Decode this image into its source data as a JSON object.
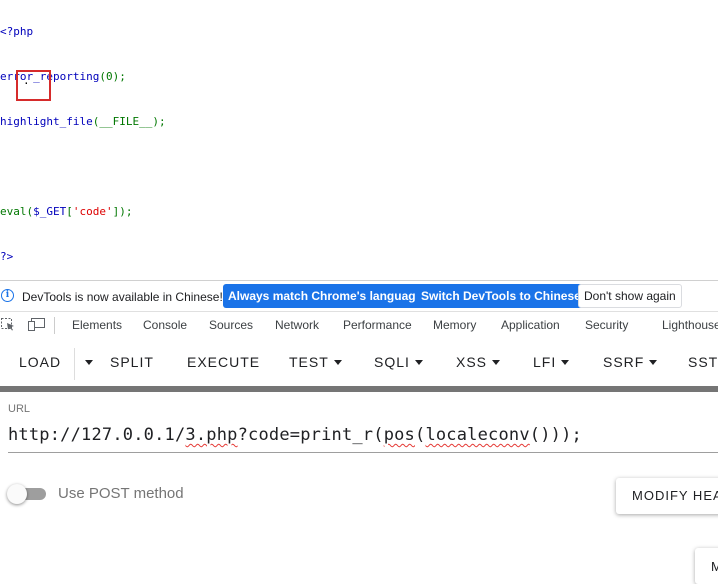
{
  "php_source": {
    "line1": "<?php",
    "line2_fn": "error_reporting",
    "line2_args": "(0);",
    "line3_fn": "highlight_file",
    "line3_args": "(__FILE__);",
    "line5_eval": "eval(",
    "line5_var": "$_GET",
    "line5_open": "[",
    "line5_key": "'code'",
    "line5_close": "]);",
    "line6": "?>",
    "output": "."
  },
  "devtools_infobar": {
    "message": "DevTools is now available in Chinese!",
    "btn_match": "Always match Chrome's language",
    "btn_switch": "Switch DevTools to Chinese",
    "btn_dismiss": "Don't show again"
  },
  "devtools_tabs": [
    "Elements",
    "Console",
    "Sources",
    "Network",
    "Performance",
    "Memory",
    "Application",
    "Security",
    "Lighthouse"
  ],
  "hackbar": {
    "load": "LOAD",
    "split": "SPLIT",
    "execute": "EXECUTE",
    "test": "TEST",
    "sqli": "SQLI",
    "xss": "XSS",
    "lfi": "LFI",
    "ssrf": "SSRF",
    "ssti": "SSTI"
  },
  "url_field": {
    "label": "URL",
    "value_part1": "http://127.0.0.1/",
    "value_part2": "3.php",
    "value_part3": "?code=print_r(",
    "value_part4": "pos",
    "value_part5": "(",
    "value_part6": "localeconv",
    "value_part7": "()));"
  },
  "post_toggle": {
    "label": "Use POST method",
    "enabled": false
  },
  "buttons": {
    "modify_headers": "MODIFY HEADER",
    "bottom_partial": "M"
  },
  "colors": {
    "php_keyword": "#0000BB",
    "php_punct": "#007700",
    "php_string": "#DD0000",
    "accent": "#1a73e8"
  }
}
